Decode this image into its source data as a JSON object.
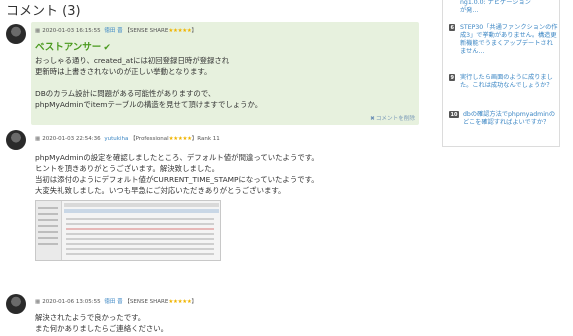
{
  "heading": "コメント (3)",
  "comments": [
    {
      "date": "2020-01-03 16:15:55",
      "user": "徳田 晋",
      "tag": "【SENSE SHARE",
      "stars": "★★★★★",
      "tag_close": "】",
      "best_label": "ベストアンサー",
      "lines": [
        "おっしゃる通り、created_atには初回登録日時が登録され",
        "更新時は上書きされないのが正しい挙動となります。",
        "",
        "DBのカラム設計に問題がある可能性がありますので、",
        "phpMyAdminでitemテーブルの構造を見せて頂けますでしょうか。"
      ],
      "delete_label": "コメントを削除"
    },
    {
      "date": "2020-01-03 22:54:36",
      "user": "yutukiha",
      "tag": "【Professional",
      "stars": "★★★★★",
      "tag_close": "】Rank 11",
      "lines": [
        "phpMyAdminの設定を確認しましたところ、デフォルト値が間違っていたようです。",
        "ヒントを頂きありがとうございます。解決致しました。",
        "当初は添付のようにデフォルト値がCURRENT_TIME_STAMPになっていたようです。",
        "大変失礼致しました。いつも早急にご対応いただきありがとうございます。"
      ]
    },
    {
      "date": "2020-01-06 13:05:55",
      "user": "徳田 晋",
      "tag": "【SENSE SHARE",
      "stars": "★★★★★",
      "tag_close": "】",
      "lines": [
        "解決されたようで良かったです。",
        "また何かありましたらご連絡ください。"
      ]
    }
  ],
  "sidebar": {
    "top_fragment": "ng1.0.0: ナビゲーション\nが発…",
    "items": [
      {
        "rank": "6",
        "text": "STEP30「共通ファンクションの作成3」で挙動がありません。構造更新機能でうまくアップデートされません…"
      },
      {
        "rank": "9",
        "text": "実行したら画面のように成りました。これは成功なんでしょうか？"
      },
      {
        "rank": "10",
        "text": "dbの確認方法でphpmyadminのどこを確認すればよいですか？"
      }
    ]
  },
  "icons": {
    "calendar": "calendar-icon",
    "check": "check-icon",
    "delete": "close-icon"
  }
}
